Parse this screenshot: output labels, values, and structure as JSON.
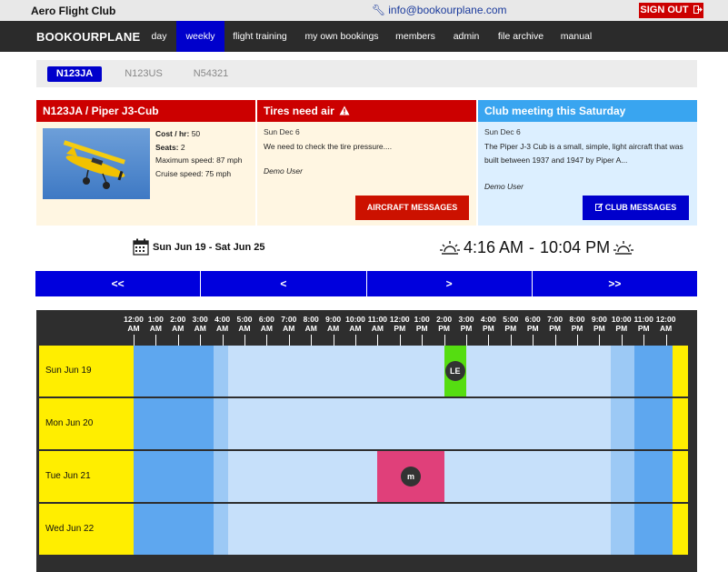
{
  "header": {
    "club_name": "Aero Flight Club",
    "email": "info@bookourplane.com",
    "signout_label": "SIGN OUT"
  },
  "nav": {
    "brand": "BOOKOURPLANE",
    "items": [
      "day",
      "weekly",
      "flight training",
      "my own bookings",
      "members",
      "admin",
      "file archive",
      "manual"
    ],
    "active": "weekly"
  },
  "aircraft_tabs": [
    "N123JA",
    "N123US",
    "N54321"
  ],
  "aircraft_panel": {
    "title": "N123JA / Piper J3-Cub",
    "cost_label": "Cost / hr:",
    "cost_value": "50",
    "seats_label": "Seats:",
    "seats_value": "2",
    "max_speed": "Maximum speed: 87 mph",
    "cruise_speed": "Cruise speed: 75 mph"
  },
  "aircraft_message": {
    "title": "Tires need air",
    "date": "Sun Dec 6",
    "text": "We need to check the tire pressure....",
    "author": "Demo User",
    "button": "AIRCRAFT MESSAGES"
  },
  "club_message": {
    "title": "Club meeting this Saturday",
    "date": "Sun Dec 6",
    "text": "The Piper J-3 Cub is a small, simple, light aircraft that was built between 1937 and 1947 by Piper A...",
    "author": "Demo User",
    "button": "CLUB MESSAGES"
  },
  "week": {
    "range": "Sun Jun 19 - Sat Jun 25",
    "sunrise": "4:16 AM",
    "separator": "-",
    "sunset": "10:04 PM"
  },
  "pager": [
    "<<",
    "<",
    ">",
    ">>"
  ],
  "calendar": {
    "hours": [
      [
        "12:00",
        "AM"
      ],
      [
        "1:00",
        "AM"
      ],
      [
        "2:00",
        "AM"
      ],
      [
        "3:00",
        "AM"
      ],
      [
        "4:00",
        "AM"
      ],
      [
        "5:00",
        "AM"
      ],
      [
        "6:00",
        "AM"
      ],
      [
        "7:00",
        "AM"
      ],
      [
        "8:00",
        "AM"
      ],
      [
        "9:00",
        "AM"
      ],
      [
        "10:00",
        "AM"
      ],
      [
        "11:00",
        "AM"
      ],
      [
        "12:00",
        "PM"
      ],
      [
        "1:00",
        "PM"
      ],
      [
        "2:00",
        "PM"
      ],
      [
        "3:00",
        "PM"
      ],
      [
        "4:00",
        "PM"
      ],
      [
        "5:00",
        "PM"
      ],
      [
        "6:00",
        "PM"
      ],
      [
        "7:00",
        "PM"
      ],
      [
        "8:00",
        "PM"
      ],
      [
        "9:00",
        "PM"
      ],
      [
        "10:00",
        "PM"
      ],
      [
        "11:00",
        "PM"
      ],
      [
        "12:00",
        "AM"
      ]
    ],
    "days": [
      "Sun Jun 19",
      "Mon Jun 20",
      "Tue Jun 21",
      "Wed Jun 22"
    ],
    "bookings": [
      {
        "day": 0,
        "start_hour": 14.0,
        "end_hour": 15.0,
        "initials": "LE",
        "color": "#55dd11"
      },
      {
        "day": 2,
        "start_hour": 11.0,
        "end_hour": 14.0,
        "initials": "m",
        "color": "#e0407a"
      }
    ]
  },
  "colors": {
    "accent_blue": "#0000cc",
    "alert_red": "#cc0000",
    "club_blue": "#39a5f0",
    "day_yellow": "#ffee00"
  }
}
